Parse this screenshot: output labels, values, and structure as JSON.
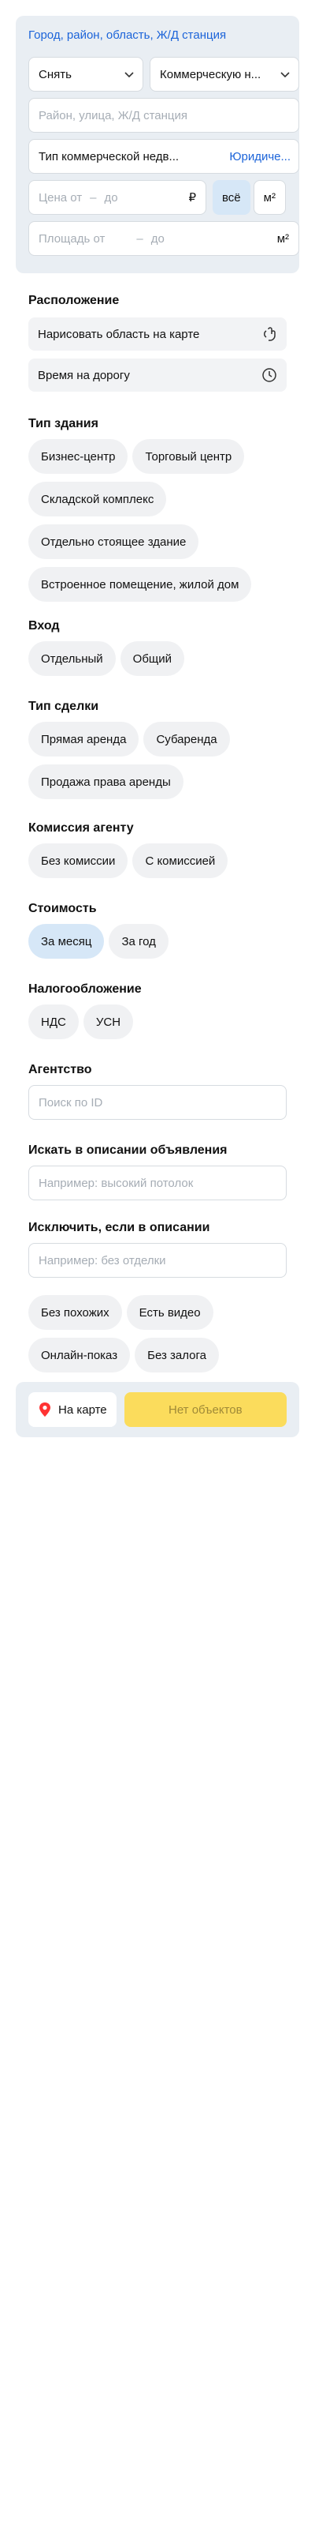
{
  "top": {
    "geo_link": "Город, район, область, Ж/Д станция",
    "deal_select": "Снять",
    "category_select": "Коммерческую н...",
    "address_placeholder": "Район, улица, Ж/Д станция",
    "type_value": "Тип коммерческой недв...",
    "legal_link": "Юридиче...",
    "price_from": "Цена от",
    "price_dash": "–",
    "price_to": "до",
    "price_unit": "₽",
    "toggle_all": "всё",
    "toggle_m2": "м²",
    "area_from": "Площадь от",
    "area_dash": "–",
    "area_to": "до",
    "area_unit": "м²"
  },
  "location": {
    "title": "Расположение",
    "draw_area": "Нарисовать область на карте",
    "travel_time": "Время на дорогу"
  },
  "building": {
    "title": "Тип здания",
    "chips": [
      "Бизнес-центр",
      "Торговый центр",
      "Складской комплекс",
      "Отдельно стоящее здание",
      "Встроенное помещение, жилой дом"
    ]
  },
  "entrance": {
    "title": "Вход",
    "chips": [
      "Отдельный",
      "Общий"
    ]
  },
  "deal": {
    "title": "Тип сделки",
    "chips": [
      "Прямая аренда",
      "Субаренда",
      "Продажа права аренды"
    ]
  },
  "commission": {
    "title": "Комиссия агенту",
    "chips": [
      "Без комиссии",
      "С комиссией"
    ]
  },
  "cost": {
    "title": "Стоимость",
    "chips": [
      "За месяц",
      "За год"
    ],
    "selected_index": 0
  },
  "tax": {
    "title": "Налогообложение",
    "chips": [
      "НДС",
      "УСН"
    ]
  },
  "agency": {
    "title": "Агентство",
    "placeholder": "Поиск по ID"
  },
  "include_desc": {
    "title": "Искать в описании объявления",
    "placeholder": "Например: высокий потолок"
  },
  "exclude_desc": {
    "title": "Исключить, если в описании",
    "placeholder": "Например: без отделки"
  },
  "extras": {
    "chips": [
      "Без похожих",
      "Есть видео",
      "Онлайн-показ",
      "Без залога"
    ]
  },
  "bottom": {
    "map_button": "На карте",
    "submit_button": "Нет объектов"
  },
  "colors": {
    "accent_blue": "#1c64d9",
    "selected_chip": "#d6e7f7",
    "submit_yellow": "#fbdc5c",
    "map_pin_red": "#f33"
  }
}
